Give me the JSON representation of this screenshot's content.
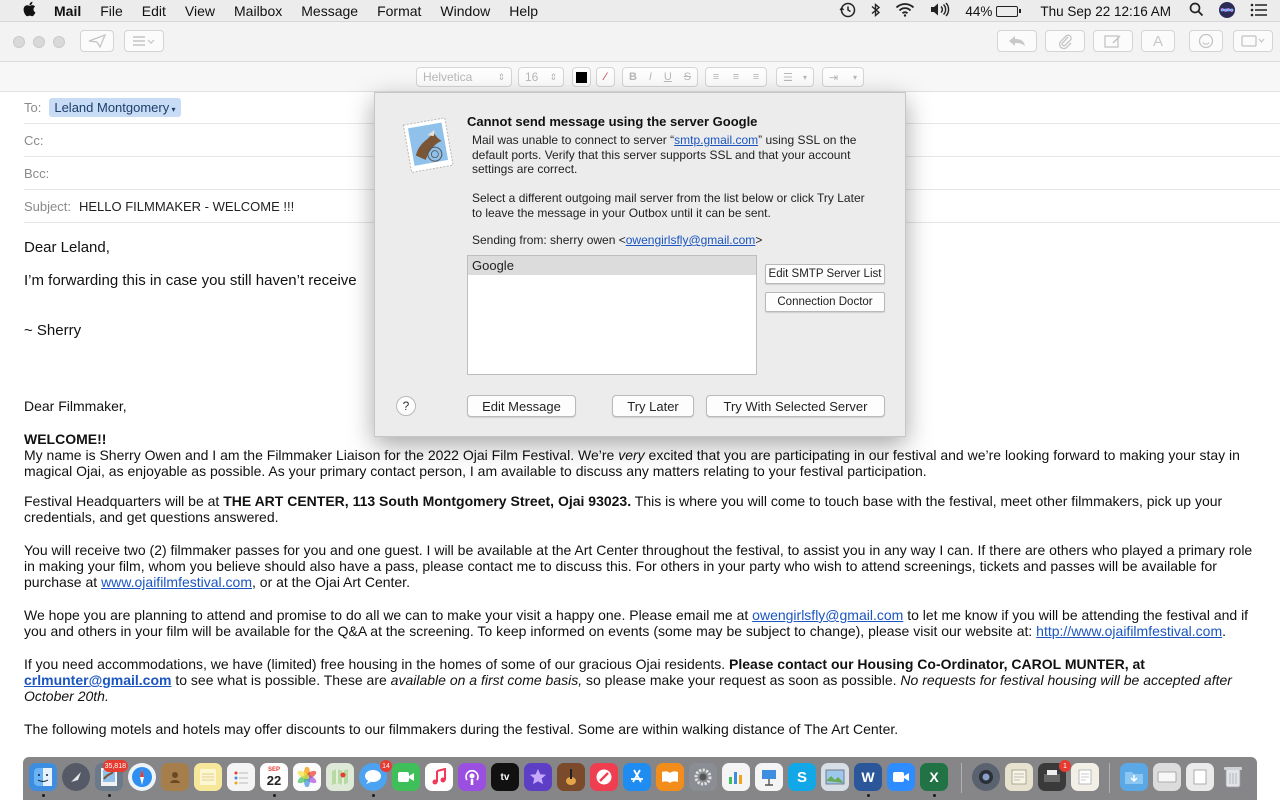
{
  "menubar": {
    "app_name": "Mail",
    "items": [
      "File",
      "Edit",
      "View",
      "Mailbox",
      "Message",
      "Format",
      "Window",
      "Help"
    ],
    "status": {
      "battery_percent": "44%",
      "battery_level": 0.44,
      "clock": "Thu Sep 22  12:16 AM"
    }
  },
  "formatbar": {
    "font_name": "Helvetica",
    "font_size": "16"
  },
  "compose": {
    "to_label": "To:",
    "to_recipient": "Leland Montgomery",
    "cc_label": "Cc:",
    "bcc_label": "Bcc:",
    "subject_label": "Subject:",
    "subject": "HELLO FILMMAKER - WELCOME !!!"
  },
  "body": {
    "greeting": "Dear Leland,",
    "forward_line": "I’m forwarding this in case you still haven’t receive",
    "signoff": "~ Sherry",
    "greeting2": "Dear Filmmaker,",
    "welcome": "WELCOME!!",
    "p1a": "My name is Sherry Owen and I am the Filmmaker Liaison for the 2022 Ojai Film Festival. We’re ",
    "p1_em": "very",
    "p1b": " excited that you are participating in our festival and we’re looking forward to making your stay in magical Ojai, as enjoyable as possible. As your primary contact person, I am available to discuss any matters relating to your festival participation.",
    "p2a": "Festival Headquarters will be at ",
    "p2_bold": "THE ART CENTER, 113 South Montgomery Street, Ojai 93023.",
    "p2b": " This is where you will come to touch base with the festival, meet other filmmakers, pick up your credentials, and get questions answered.",
    "p3a": "You will receive two (2) filmmaker passes for you and one guest. I will be available at the Art Center throughout the festival, to assist you in any way I can. If there are others who played a primary role in making your film, whom you believe should also have a pass, please contact me to discuss this. For others in your party who wish to attend screenings, tickets and passes will be available for purchase at ",
    "p3_link": "www.ojaifilmfestival.com",
    "p3b": ", or at the Ojai Art Center.",
    "p4a": "We hope you are planning to attend and promise to do all we can to make your visit a happy one. Please email me at ",
    "p4_link1": "owengirlsfly@gmail.com",
    "p4b": " to let me know if you will be attending the festival and if you and others in your film will be available for the Q&A at the screening. To keep informed on events (some may be subject to change), please visit our website at: ",
    "p4_link2": "http://www.ojaifilmfestival.com",
    "p4c": ".",
    "p5a": "If you need accommodations, we have (limited) free housing in the homes of some of our gracious Ojai residents. ",
    "p5_bold": "Please contact our Housing Co-Ordinator, CAROL MUNTER, at ",
    "p5_link": "crlmunter@gmail.com",
    "p5b": " to see what is possible. These are ",
    "p5_em": "available on a first come basis,",
    "p5c": " so please make your request as soon as possible. ",
    "p5_em2": "No requests for festival housing will be accepted after October 20th.",
    "p6": "The following motels and hotels may offer discounts to our filmmakers during the festival. Some are within walking distance of The Art Center."
  },
  "alert": {
    "title": "Cannot send message using the server Google",
    "line1a": "Mail was unable to connect to server “",
    "line1_link": "smtp.gmail.com",
    "line1b": "” using SSL on the",
    "line2": "default ports. Verify that this server supports SSL and that your account",
    "line3": "settings are correct.",
    "line4": "Select a different outgoing mail server from the list below or click Try Later",
    "line5": "to leave the message in your Outbox until it can be sent.",
    "sending_from_a": "Sending from: sherry owen <",
    "sending_from_link": "owengirlsfly@gmail.com",
    "sending_from_b": ">",
    "servers": [
      "Google"
    ],
    "edit_smtp_label": "Edit SMTP Server List",
    "connection_doctor_label": "Connection Doctor",
    "help_label": "?",
    "edit_message_label": "Edit Message",
    "try_later_label": "Try Later",
    "try_selected_label": "Try With Selected Server"
  },
  "dock": {
    "mail_badge": "35,818",
    "calendar_month": "SEP",
    "calendar_day": "22",
    "messages_badge": "14",
    "app_store_badge": "1"
  },
  "colors": {
    "link": "#1a55c0",
    "token_bg": "#c8dcf6",
    "sheet_bg": "#ececec",
    "dock_bg": "#3c3c40"
  }
}
